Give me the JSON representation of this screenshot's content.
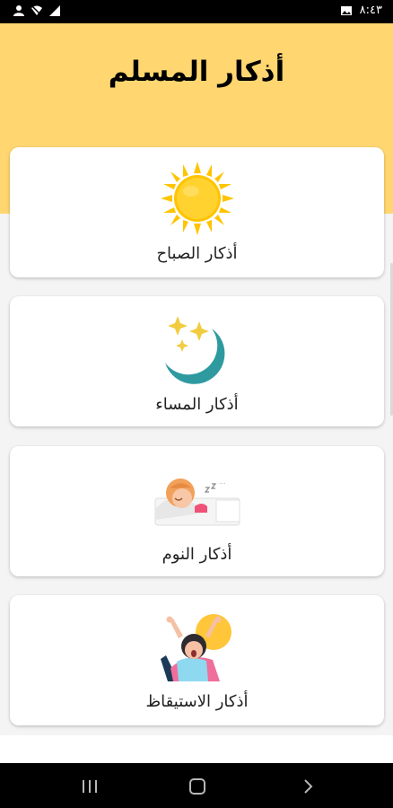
{
  "status_bar": {
    "time": "٨:٤٣",
    "icons": [
      "user-icon",
      "wifi-off-icon",
      "signal-icon",
      "image-icon"
    ]
  },
  "header": {
    "title": "أذكار المسلم",
    "background": "#ffd670"
  },
  "cards": [
    {
      "label": "أذكار الصباح",
      "icon": "sun-icon"
    },
    {
      "label": "أذكار المساء",
      "icon": "moon-stars-icon"
    },
    {
      "label": "أذكار النوم",
      "icon": "sleeping-person-icon"
    },
    {
      "label": "أذكار الاستيقاظ",
      "icon": "waking-person-icon"
    }
  ],
  "navigation": {
    "buttons": [
      "recent-apps",
      "home",
      "back"
    ]
  }
}
